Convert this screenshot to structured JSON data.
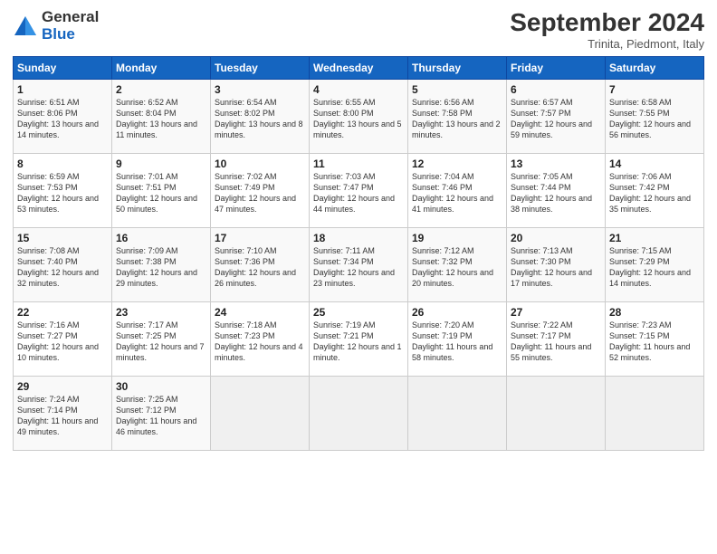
{
  "header": {
    "logo_general": "General",
    "logo_blue": "Blue",
    "month_title": "September 2024",
    "subtitle": "Trinita, Piedmont, Italy"
  },
  "days_of_week": [
    "Sunday",
    "Monday",
    "Tuesday",
    "Wednesday",
    "Thursday",
    "Friday",
    "Saturday"
  ],
  "weeks": [
    [
      {
        "day": 1,
        "sunrise": "6:51 AM",
        "sunset": "8:06 PM",
        "daylight": "13 hours and 14 minutes."
      },
      {
        "day": 2,
        "sunrise": "6:52 AM",
        "sunset": "8:04 PM",
        "daylight": "13 hours and 11 minutes."
      },
      {
        "day": 3,
        "sunrise": "6:54 AM",
        "sunset": "8:02 PM",
        "daylight": "13 hours and 8 minutes."
      },
      {
        "day": 4,
        "sunrise": "6:55 AM",
        "sunset": "8:00 PM",
        "daylight": "13 hours and 5 minutes."
      },
      {
        "day": 5,
        "sunrise": "6:56 AM",
        "sunset": "7:58 PM",
        "daylight": "13 hours and 2 minutes."
      },
      {
        "day": 6,
        "sunrise": "6:57 AM",
        "sunset": "7:57 PM",
        "daylight": "12 hours and 59 minutes."
      },
      {
        "day": 7,
        "sunrise": "6:58 AM",
        "sunset": "7:55 PM",
        "daylight": "12 hours and 56 minutes."
      }
    ],
    [
      {
        "day": 8,
        "sunrise": "6:59 AM",
        "sunset": "7:53 PM",
        "daylight": "12 hours and 53 minutes."
      },
      {
        "day": 9,
        "sunrise": "7:01 AM",
        "sunset": "7:51 PM",
        "daylight": "12 hours and 50 minutes."
      },
      {
        "day": 10,
        "sunrise": "7:02 AM",
        "sunset": "7:49 PM",
        "daylight": "12 hours and 47 minutes."
      },
      {
        "day": 11,
        "sunrise": "7:03 AM",
        "sunset": "7:47 PM",
        "daylight": "12 hours and 44 minutes."
      },
      {
        "day": 12,
        "sunrise": "7:04 AM",
        "sunset": "7:46 PM",
        "daylight": "12 hours and 41 minutes."
      },
      {
        "day": 13,
        "sunrise": "7:05 AM",
        "sunset": "7:44 PM",
        "daylight": "12 hours and 38 minutes."
      },
      {
        "day": 14,
        "sunrise": "7:06 AM",
        "sunset": "7:42 PM",
        "daylight": "12 hours and 35 minutes."
      }
    ],
    [
      {
        "day": 15,
        "sunrise": "7:08 AM",
        "sunset": "7:40 PM",
        "daylight": "12 hours and 32 minutes."
      },
      {
        "day": 16,
        "sunrise": "7:09 AM",
        "sunset": "7:38 PM",
        "daylight": "12 hours and 29 minutes."
      },
      {
        "day": 17,
        "sunrise": "7:10 AM",
        "sunset": "7:36 PM",
        "daylight": "12 hours and 26 minutes."
      },
      {
        "day": 18,
        "sunrise": "7:11 AM",
        "sunset": "7:34 PM",
        "daylight": "12 hours and 23 minutes."
      },
      {
        "day": 19,
        "sunrise": "7:12 AM",
        "sunset": "7:32 PM",
        "daylight": "12 hours and 20 minutes."
      },
      {
        "day": 20,
        "sunrise": "7:13 AM",
        "sunset": "7:30 PM",
        "daylight": "12 hours and 17 minutes."
      },
      {
        "day": 21,
        "sunrise": "7:15 AM",
        "sunset": "7:29 PM",
        "daylight": "12 hours and 14 minutes."
      }
    ],
    [
      {
        "day": 22,
        "sunrise": "7:16 AM",
        "sunset": "7:27 PM",
        "daylight": "12 hours and 10 minutes."
      },
      {
        "day": 23,
        "sunrise": "7:17 AM",
        "sunset": "7:25 PM",
        "daylight": "12 hours and 7 minutes."
      },
      {
        "day": 24,
        "sunrise": "7:18 AM",
        "sunset": "7:23 PM",
        "daylight": "12 hours and 4 minutes."
      },
      {
        "day": 25,
        "sunrise": "7:19 AM",
        "sunset": "7:21 PM",
        "daylight": "12 hours and 1 minute."
      },
      {
        "day": 26,
        "sunrise": "7:20 AM",
        "sunset": "7:19 PM",
        "daylight": "11 hours and 58 minutes."
      },
      {
        "day": 27,
        "sunrise": "7:22 AM",
        "sunset": "7:17 PM",
        "daylight": "11 hours and 55 minutes."
      },
      {
        "day": 28,
        "sunrise": "7:23 AM",
        "sunset": "7:15 PM",
        "daylight": "11 hours and 52 minutes."
      }
    ],
    [
      {
        "day": 29,
        "sunrise": "7:24 AM",
        "sunset": "7:14 PM",
        "daylight": "11 hours and 49 minutes."
      },
      {
        "day": 30,
        "sunrise": "7:25 AM",
        "sunset": "7:12 PM",
        "daylight": "11 hours and 46 minutes."
      },
      null,
      null,
      null,
      null,
      null
    ]
  ]
}
